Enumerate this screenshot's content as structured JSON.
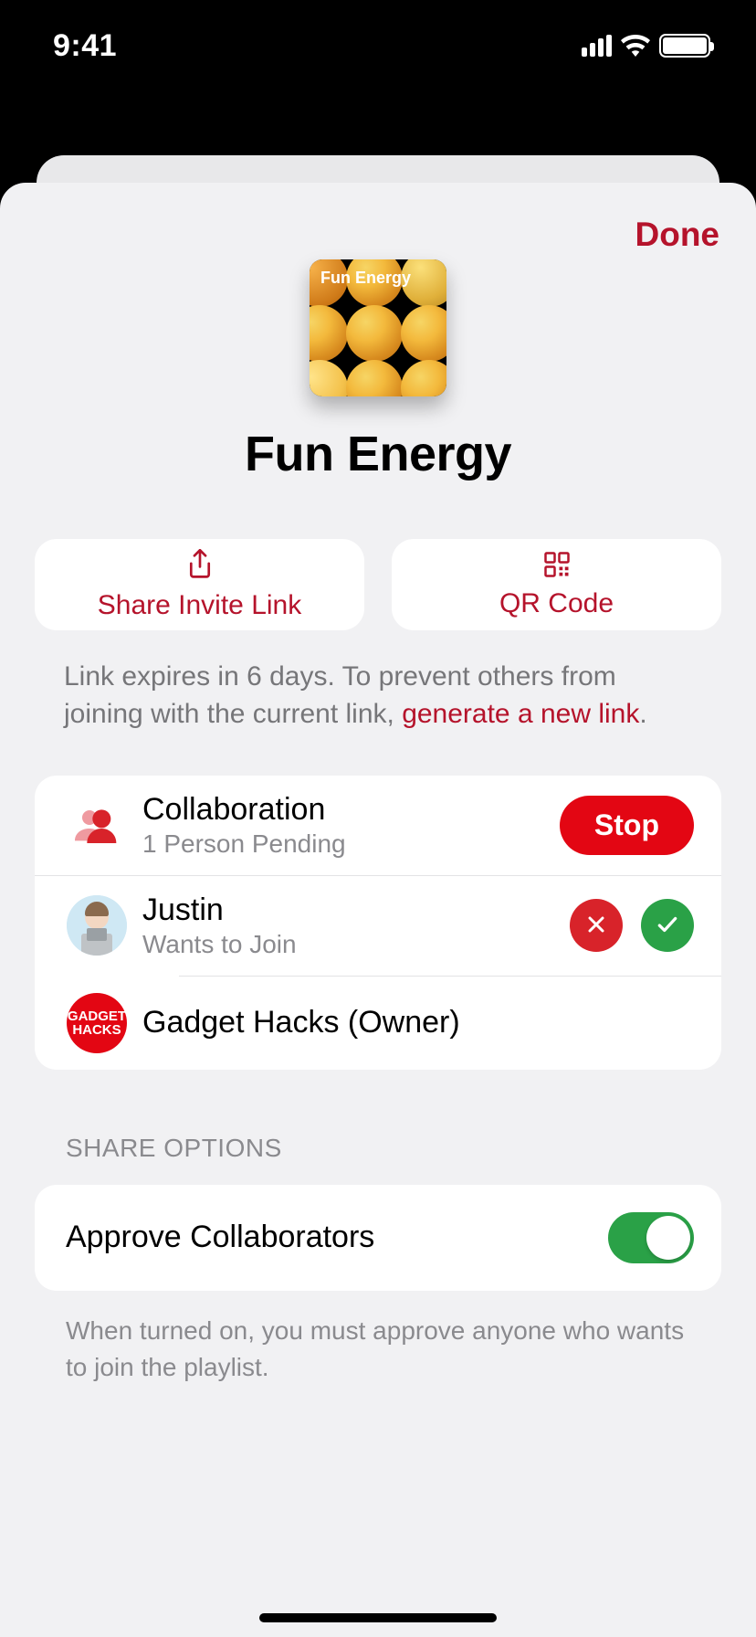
{
  "status": {
    "time": "9:41"
  },
  "header": {
    "done": "Done"
  },
  "playlist": {
    "title": "Fun Energy",
    "cover_label": "Fun Energy"
  },
  "actions": {
    "share_invite": "Share Invite Link",
    "qr_code": "QR Code"
  },
  "expiry": {
    "prefix": "Link expires in 6 days. To prevent others from joining with the current link, ",
    "link_text": "generate a new link",
    "suffix": "."
  },
  "collaboration": {
    "title": "Collaboration",
    "subtitle": "1 Person Pending",
    "stop": "Stop",
    "pending": {
      "name": "Justin",
      "status": "Wants to Join"
    },
    "owner": {
      "name": "Gadget Hacks (Owner)",
      "avatar_line1": "GADGET",
      "avatar_line2": "HACKS"
    }
  },
  "share_options": {
    "header": "SHARE OPTIONS",
    "approve_label": "Approve Collaborators",
    "approve_on": true,
    "note": "When turned on, you must approve anyone who wants to join the playlist."
  },
  "colors": {
    "accent": "#b5132b",
    "danger": "#e30613",
    "success": "#2aa147"
  }
}
